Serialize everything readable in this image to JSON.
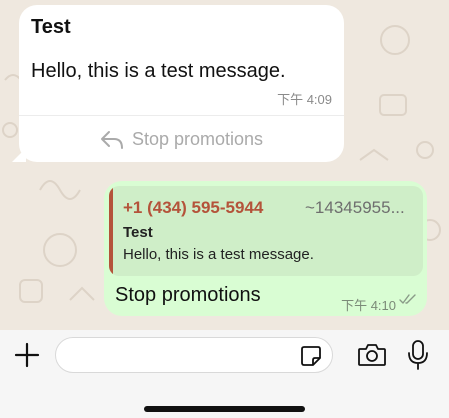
{
  "chat": {
    "incoming": {
      "title": "Test",
      "text": "Hello, this is a test message.",
      "time": "下午 4:09",
      "stop_label": "Stop promotions"
    },
    "outgoing": {
      "quote_sender": "+1 (434) 595-5944",
      "quote_number": "~14345955...",
      "quote_title": "Test",
      "quote_text": "Hello, this is a test message.",
      "text": "Stop promotions",
      "time": "下午 4:10",
      "status_icon": "double-check-icon"
    }
  },
  "composer": {
    "placeholder": "",
    "icons": [
      "plus-icon",
      "sticker-icon",
      "camera-icon",
      "microphone-icon"
    ]
  },
  "colors": {
    "wallpaper": "#efe8df",
    "incoming_bubble": "#ffffff",
    "outgoing_bubble": "#d9fdd3",
    "quote_accent": "#b4533a"
  }
}
